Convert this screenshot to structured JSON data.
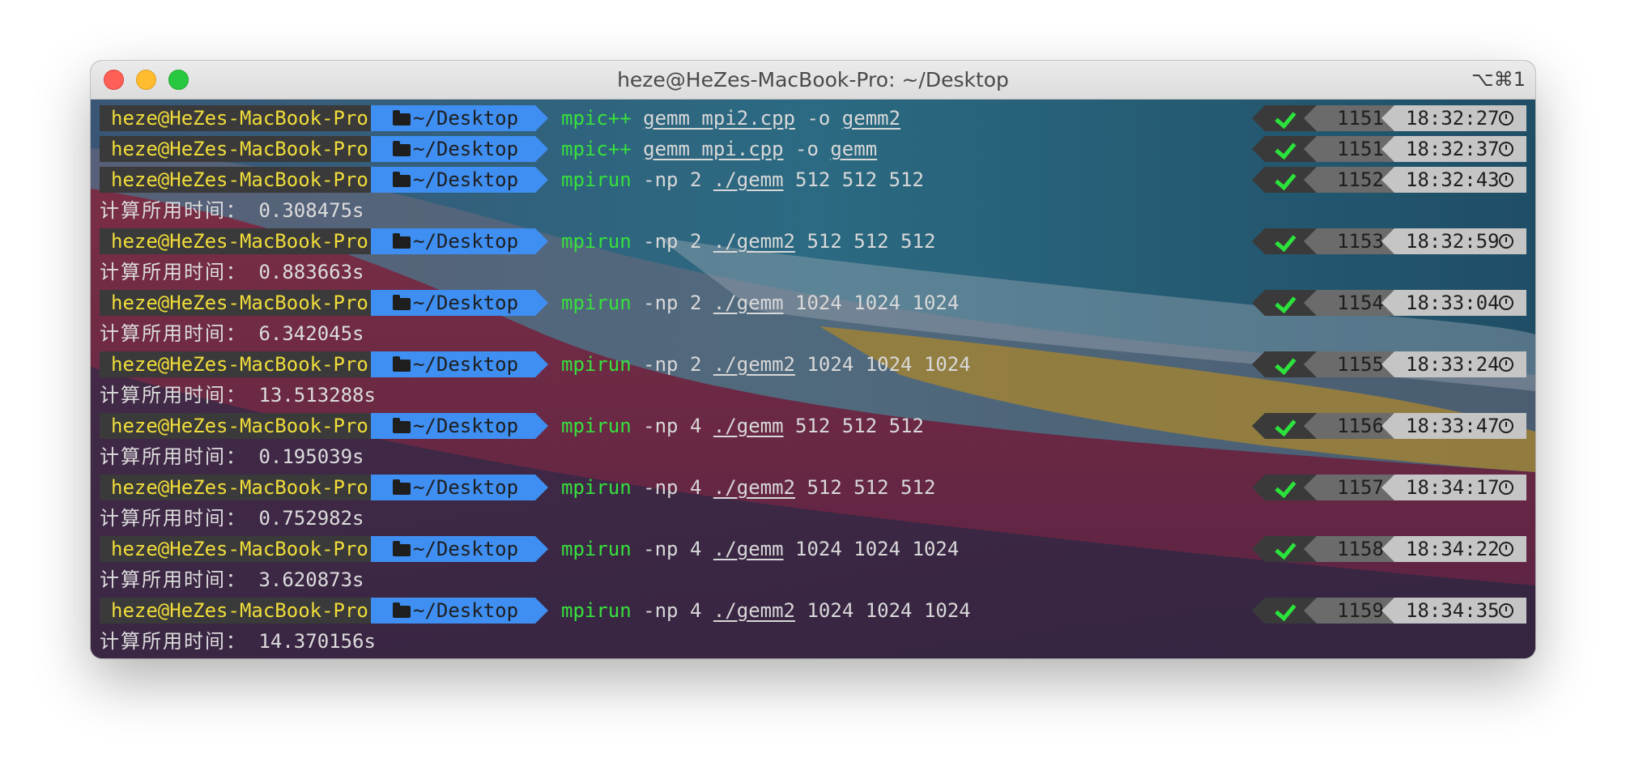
{
  "window": {
    "title": "heze@HeZes-MacBook-Pro: ~/Desktop",
    "shortcut": "⌥⌘1"
  },
  "prompt": {
    "user": "heze@HeZes-MacBook-Pro",
    "dir": "~/Desktop"
  },
  "lines": [
    {
      "type": "cmd",
      "prog": "mpic++",
      "pre": " ",
      "file": "gemm_mpi2.cpp",
      "mid": " -o ",
      "file2": "gemm2",
      "post": "",
      "num": "1151",
      "time": "18:32:27"
    },
    {
      "type": "cmd",
      "prog": "mpic++",
      "pre": " ",
      "file": "gemm_mpi.cpp",
      "mid": " -o ",
      "file2": "gemm",
      "post": "",
      "num": "1151",
      "time": "18:32:37"
    },
    {
      "type": "cmd",
      "prog": "mpirun",
      "pre": " -np 2 ",
      "file": "./gemm",
      "mid": " 512 512 512",
      "file2": "",
      "post": "",
      "num": "1152",
      "time": "18:32:43"
    },
    {
      "type": "out",
      "label": "计算所用时间：",
      "value": " 0.308475s"
    },
    {
      "type": "cmd",
      "prog": "mpirun",
      "pre": " -np 2 ",
      "file": "./gemm2",
      "mid": " 512 512 512",
      "file2": "",
      "post": "",
      "num": "1153",
      "time": "18:32:59"
    },
    {
      "type": "out",
      "label": "计算所用时间：",
      "value": " 0.883663s"
    },
    {
      "type": "cmd",
      "prog": "mpirun",
      "pre": " -np 2 ",
      "file": "./gemm",
      "mid": " 1024 1024 1024",
      "file2": "",
      "post": "",
      "num": "1154",
      "time": "18:33:04"
    },
    {
      "type": "out",
      "label": "计算所用时间：",
      "value": " 6.342045s"
    },
    {
      "type": "cmd",
      "prog": "mpirun",
      "pre": " -np 2 ",
      "file": "./gemm2",
      "mid": " 1024 1024 1024",
      "file2": "",
      "post": "",
      "num": "1155",
      "time": "18:33:24"
    },
    {
      "type": "out",
      "label": "计算所用时间：",
      "value": " 13.513288s"
    },
    {
      "type": "cmd",
      "prog": "mpirun",
      "pre": " -np 4 ",
      "file": "./gemm",
      "mid": " 512 512 512",
      "file2": "",
      "post": "",
      "num": "1156",
      "time": "18:33:47"
    },
    {
      "type": "out",
      "label": "计算所用时间：",
      "value": " 0.195039s"
    },
    {
      "type": "cmd",
      "prog": "mpirun",
      "pre": " -np 4 ",
      "file": "./gemm2",
      "mid": " 512 512 512",
      "file2": "",
      "post": "",
      "num": "1157",
      "time": "18:34:17"
    },
    {
      "type": "out",
      "label": "计算所用时间：",
      "value": " 0.752982s"
    },
    {
      "type": "cmd",
      "prog": "mpirun",
      "pre": " -np 4 ",
      "file": "./gemm",
      "mid": " 1024 1024 1024",
      "file2": "",
      "post": "",
      "num": "1158",
      "time": "18:34:22"
    },
    {
      "type": "out",
      "label": "计算所用时间：",
      "value": " 3.620873s"
    },
    {
      "type": "cmd",
      "prog": "mpirun",
      "pre": " -np 4 ",
      "file": "./gemm2",
      "mid": " 1024 1024 1024",
      "file2": "",
      "post": "",
      "num": "1159",
      "time": "18:34:35"
    },
    {
      "type": "out",
      "label": "计算所用时间：",
      "value": " 14.370156s"
    }
  ]
}
